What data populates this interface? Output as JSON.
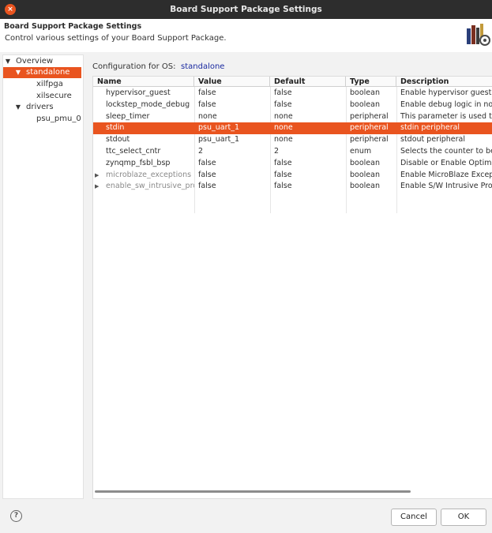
{
  "window": {
    "title": "Board Support Package Settings",
    "close_glyph": "×"
  },
  "header": {
    "title": "Board Support Package Settings",
    "description": "Control various settings of your Board Support Package."
  },
  "tree": {
    "items": [
      {
        "label": "Overview",
        "expanded": true
      },
      {
        "label": "standalone",
        "expanded": true,
        "selected": true
      },
      {
        "label": "xilfpga"
      },
      {
        "label": "xilsecure"
      },
      {
        "label": "drivers",
        "expanded": true
      },
      {
        "label": "psu_pmu_0"
      }
    ]
  },
  "config": {
    "label": "Configuration for OS:",
    "os": "standalone"
  },
  "table": {
    "headers": [
      "Name",
      "Value",
      "Default",
      "Type",
      "Description"
    ],
    "rows": [
      {
        "name": "hypervisor_guest",
        "value": "false",
        "default": "false",
        "type": "boolean",
        "description": "Enable hypervisor guest s"
      },
      {
        "name": "lockstep_mode_debug",
        "value": "false",
        "default": "false",
        "type": "boolean",
        "description": "Enable debug logic in non"
      },
      {
        "name": "sleep_timer",
        "value": "none",
        "default": "none",
        "type": "peripheral",
        "description": "This parameter is used to"
      },
      {
        "name": "stdin",
        "value": "psu_uart_1",
        "default": "none",
        "type": "peripheral",
        "description": "stdin peripheral",
        "selected": true
      },
      {
        "name": "stdout",
        "value": "psu_uart_1",
        "default": "none",
        "type": "peripheral",
        "description": "stdout peripheral"
      },
      {
        "name": "ttc_select_cntr",
        "value": "2",
        "default": "2",
        "type": "enum",
        "description": "Selects the counter to be"
      },
      {
        "name": "zynqmp_fsbl_bsp",
        "value": "false",
        "default": "false",
        "type": "boolean",
        "description": "Disable or Enable Optimiz"
      },
      {
        "name": "microblaze_exceptions",
        "value": "false",
        "default": "false",
        "type": "boolean",
        "description": "Enable MicroBlaze Except",
        "expandable": true
      },
      {
        "name": "enable_sw_intrusive_prof",
        "value": "false",
        "default": "false",
        "type": "boolean",
        "description": "Enable S/W Intrusive Prof",
        "expandable": true
      }
    ]
  },
  "footer": {
    "help_glyph": "?",
    "cancel_label": "Cancel",
    "ok_label": "OK"
  },
  "icons": {
    "expanded": "▼",
    "collapsed": "▶",
    "help": "help-icon",
    "close": "close-icon",
    "logo": "bsp-logo-icon"
  },
  "colors": {
    "accent": "#e9541f",
    "titlebar": "#2d2d2d",
    "link": "#1a2aa0"
  }
}
